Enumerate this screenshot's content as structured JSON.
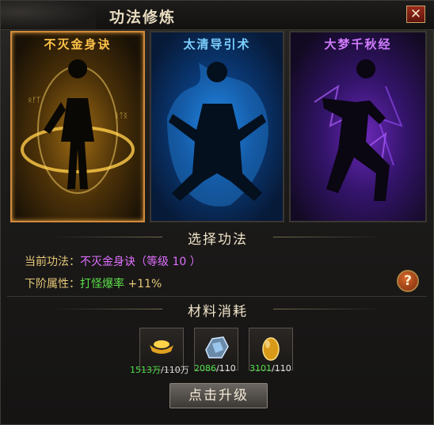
{
  "window": {
    "title": "功法修炼",
    "close_glyph": "✕"
  },
  "cards": [
    {
      "name": "不灭金身诀",
      "color": "#ffc24a"
    },
    {
      "name": "太清导引术",
      "color": "#7cd0ff"
    },
    {
      "name": "大梦千秋经",
      "color": "#d07cff"
    }
  ],
  "section_select": {
    "title": "选择功法"
  },
  "current": {
    "label": "当前功法：",
    "value": "不灭金身诀（等级 10 ）"
  },
  "next": {
    "label": "下阶属性：",
    "attr": "打怪爆率",
    "bonus": "+11%"
  },
  "help_glyph": "?",
  "section_materials": {
    "title": "材料消耗"
  },
  "materials": [
    {
      "icon": "gold-ingot-icon",
      "have": "1513万",
      "need": "/110万"
    },
    {
      "icon": "crystal-ore-icon",
      "have": "2086",
      "need": "/110"
    },
    {
      "icon": "golden-egg-icon",
      "have": "3101",
      "need": "/110"
    }
  ],
  "upgrade_button": "点击升级"
}
